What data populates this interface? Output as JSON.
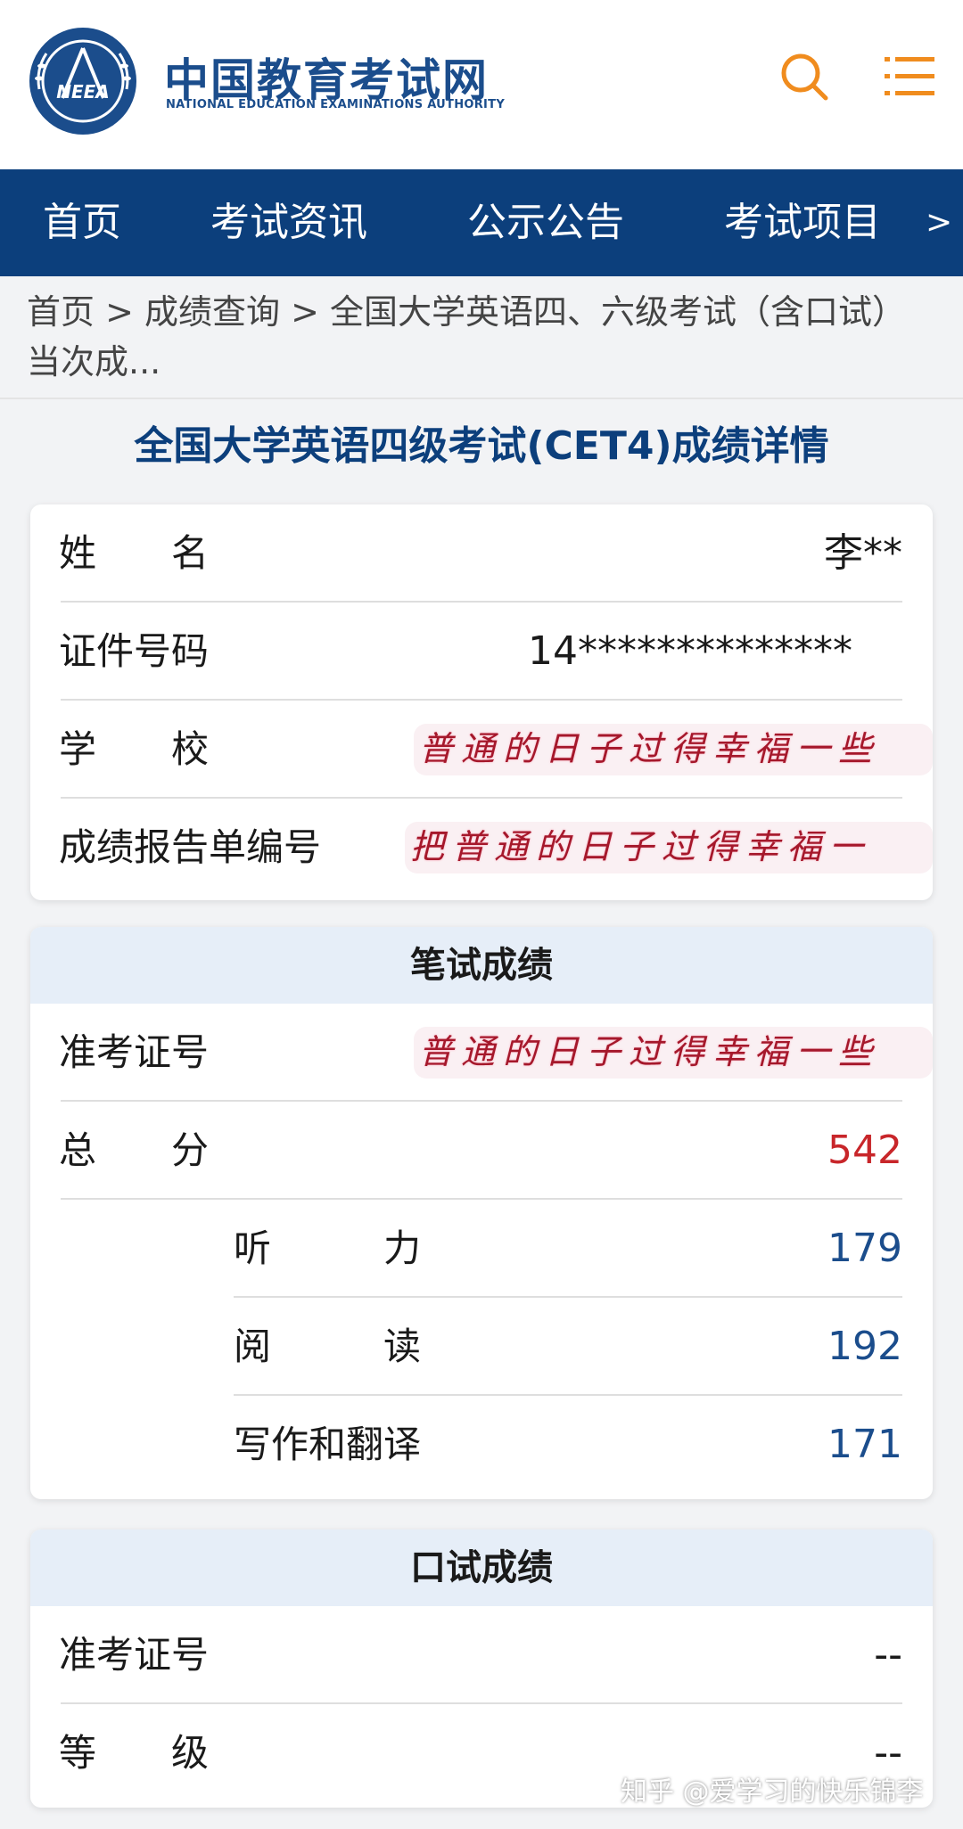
{
  "header": {
    "site_name": "中国教育考试网",
    "site_subtitle": "NATIONAL EDUCATION EXAMINATIONS AUTHORITY",
    "logo_text": "NEEA",
    "brand_color": "#1b4d8c",
    "accent_color": "#f08c1e"
  },
  "nav": {
    "items": [
      "首页",
      "考试资讯",
      "公示公告",
      "考试项目"
    ],
    "more": ">"
  },
  "breadcrumb": "首页 > 成绩查询 > 全国大学英语四、六级考试（含口试）当次成...",
  "page_title": "全国大学英语四级考试(CET4)成绩详情",
  "info": {
    "name_label": "姓　　名",
    "name_value": "李**",
    "id_label": "证件号码",
    "id_value": "14**************",
    "school_label": "学　　校",
    "school_value": "普通的日子过得幸福一些",
    "report_label": "成绩报告单编号",
    "report_value": "把普通的日子过得幸福一"
  },
  "written": {
    "title": "笔试成绩",
    "ticket_label": "准考证号",
    "ticket_value": "普通的日子过得幸福一些",
    "total_label": "总　　分",
    "total_value": "542",
    "listening_label": "听　　　力",
    "listening_value": "179",
    "reading_label": "阅　　　读",
    "reading_value": "192",
    "writing_label": "写作和翻译",
    "writing_value": "171"
  },
  "oral": {
    "title": "口试成绩",
    "ticket_label": "准考证号",
    "ticket_value": "--",
    "grade_label": "等　　级",
    "grade_value": "--"
  },
  "watermark": "知乎 @爱学习的快乐锦李",
  "colors": {
    "nav_bg": "#0c3f7c",
    "total_red": "#c8262a",
    "score_blue": "#1b4d8c"
  }
}
